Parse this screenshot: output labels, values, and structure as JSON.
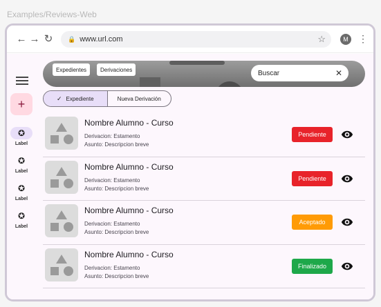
{
  "frame_label": "Examples/Reviews-Web",
  "browser": {
    "url": "www.url.com",
    "avatar_initial": "M"
  },
  "rail": {
    "items": [
      {
        "label": "Label",
        "active": true
      },
      {
        "label": "Label",
        "active": false
      },
      {
        "label": "Label",
        "active": false
      },
      {
        "label": "Label",
        "active": false
      }
    ]
  },
  "toolbar": {
    "chips": [
      "Expedientes",
      "Derivaciones"
    ],
    "search_placeholder": "Buscar"
  },
  "segmented": {
    "options": [
      "Expediente",
      "Nueva Derivación"
    ],
    "selected": "Expediente"
  },
  "list": {
    "items": [
      {
        "title": "Nombre Alumno - Curso",
        "line1": "Derivacion: Estamento",
        "line2": "Asunto: Descripcion breve",
        "status": "Pendiente",
        "status_color": "#e8232a"
      },
      {
        "title": "Nombre Alumno - Curso",
        "line1": "Derivacion: Estamento",
        "line2": "Asunto: Descripcion breve",
        "status": "Pendiente",
        "status_color": "#e8232a"
      },
      {
        "title": "Nombre Alumno - Curso",
        "line1": "Derivacion: Estamento",
        "line2": "Asunto: Descripcion breve",
        "status": "Aceptado",
        "status_color": "#ff9b06"
      },
      {
        "title": "Nombre Alumno - Curso",
        "line1": "Derivacion: Estamento",
        "line2": "Asunto: Descripcion breve",
        "status": "Finalizado",
        "status_color": "#1ea84a"
      }
    ]
  },
  "icons": {
    "menu": "menu-icon",
    "add": "add-icon",
    "rail": "star-circle-icon",
    "view": "eye-icon",
    "clear": "close-icon",
    "check": "check-icon"
  }
}
